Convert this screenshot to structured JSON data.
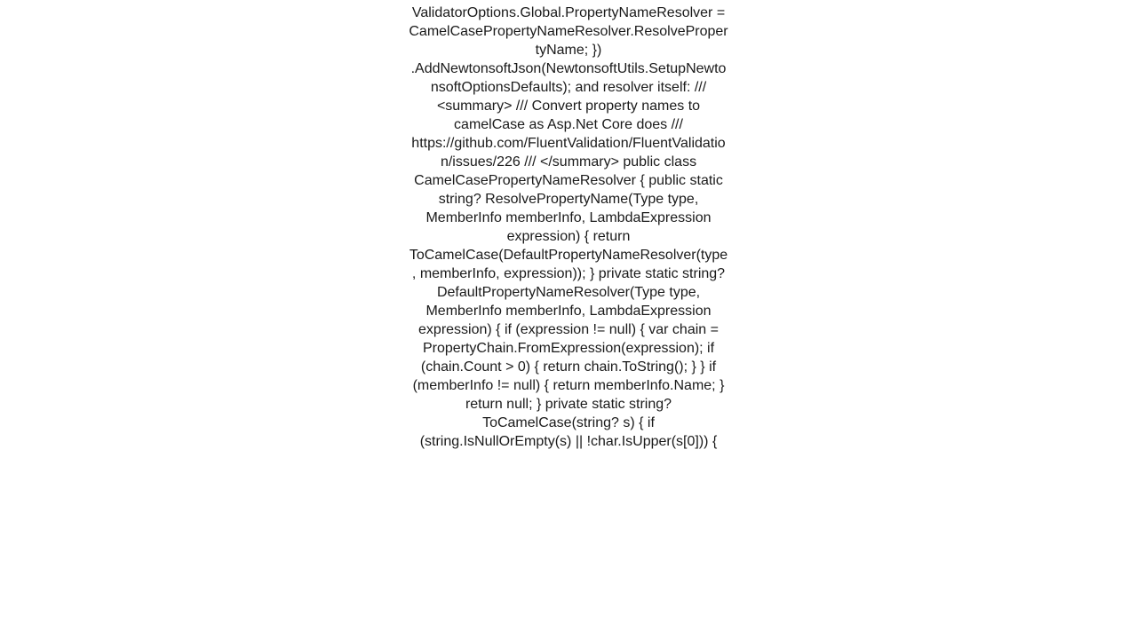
{
  "document": {
    "body": "ValidatorOptions.Global.PropertyNameResolver = CamelCasePropertyNameResolver.ResolvePropertyName;     })     .AddNewtonsoftJson(NewtonsoftUtils.SetupNewtonsoftOptionsDefaults);  and resolver itself:  /// <summary> /// Convert property names to camelCase as Asp.Net Core does  /// https://github.com/FluentValidation/FluentValidation/issues/226 /// </summary> public class CamelCasePropertyNameResolver {      public static string? ResolvePropertyName(Type type, MemberInfo memberInfo, LambdaExpression expression)     {         return ToCamelCase(DefaultPropertyNameResolver(type, memberInfo, expression));     }      private static string? DefaultPropertyNameResolver(Type type, MemberInfo memberInfo, LambdaExpression expression)     {         if (expression != null)         {             var chain = PropertyChain.FromExpression(expression);             if (chain.Count > 0)             {                 return chain.ToString();             }         }          if (memberInfo != null)         {             return memberInfo.Name;         }          return null;     }      private static string? ToCamelCase(string? s)     {         if (string.IsNullOrEmpty(s) || !char.IsUpper(s[0]))         {"
  }
}
